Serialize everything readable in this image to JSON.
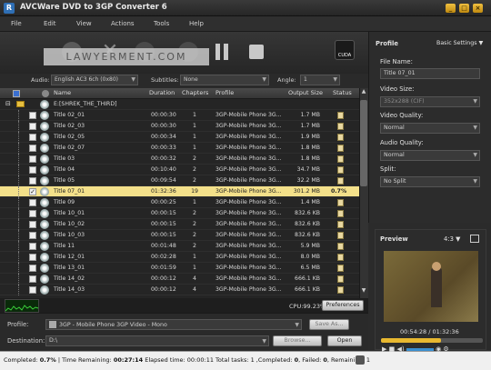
{
  "window": {
    "title": "AVCWare DVD to 3GP Converter 6",
    "logo_letter": "R"
  },
  "menu": [
    "File",
    "Edit",
    "View",
    "Actions",
    "Tools",
    "Help"
  ],
  "toolbar": {
    "watermark": "LAWYERMENT.COM",
    "cuda_label": "CUDA"
  },
  "options": {
    "audio_label": "Audio:",
    "audio_value": "English AC3 6ch (0x80)",
    "subtitles_label": "Subtitles:",
    "subtitles_value": "None",
    "angle_label": "Angle:",
    "angle_value": "1"
  },
  "table": {
    "headers": {
      "name": "Name",
      "duration": "Duration",
      "chapters": "Chapters",
      "profile": "Profile",
      "output_size": "Output Size",
      "status": "Status"
    },
    "root": "E:[SHREK_THE_THIRD]",
    "rows": [
      {
        "name": "Title 02_01",
        "duration": "00:00:30",
        "chapters": "1",
        "profile": "3GP-Mobile Phone 3G...",
        "size": "1.7 MB",
        "status": ""
      },
      {
        "name": "Title 02_03",
        "duration": "00:00:30",
        "chapters": "1",
        "profile": "3GP-Mobile Phone 3G...",
        "size": "1.7 MB",
        "status": ""
      },
      {
        "name": "Title 02_05",
        "duration": "00:00:34",
        "chapters": "1",
        "profile": "3GP-Mobile Phone 3G...",
        "size": "1.9 MB",
        "status": ""
      },
      {
        "name": "Title 02_07",
        "duration": "00:00:33",
        "chapters": "1",
        "profile": "3GP-Mobile Phone 3G...",
        "size": "1.8 MB",
        "status": ""
      },
      {
        "name": "Title 03",
        "duration": "00:00:32",
        "chapters": "2",
        "profile": "3GP-Mobile Phone 3G...",
        "size": "1.8 MB",
        "status": ""
      },
      {
        "name": "Title 04",
        "duration": "00:10:40",
        "chapters": "2",
        "profile": "3GP-Mobile Phone 3G...",
        "size": "34.7 MB",
        "status": ""
      },
      {
        "name": "Title 05",
        "duration": "00:09:54",
        "chapters": "2",
        "profile": "3GP-Mobile Phone 3G...",
        "size": "32.2 MB",
        "status": ""
      },
      {
        "name": "Title 07_01",
        "duration": "01:32:36",
        "chapters": "19",
        "profile": "3GP-Mobile Phone 3G...",
        "size": "301.2 MB",
        "status": "0.7%",
        "selected": true
      },
      {
        "name": "Title 09",
        "duration": "00:00:25",
        "chapters": "1",
        "profile": "3GP-Mobile Phone 3G...",
        "size": "1.4 MB",
        "status": ""
      },
      {
        "name": "Title 10_01",
        "duration": "00:00:15",
        "chapters": "2",
        "profile": "3GP-Mobile Phone 3G...",
        "size": "832.6 KB",
        "status": ""
      },
      {
        "name": "Title 10_02",
        "duration": "00:00:15",
        "chapters": "2",
        "profile": "3GP-Mobile Phone 3G...",
        "size": "832.6 KB",
        "status": ""
      },
      {
        "name": "Title 10_03",
        "duration": "00:00:15",
        "chapters": "2",
        "profile": "3GP-Mobile Phone 3G...",
        "size": "832.6 KB",
        "status": ""
      },
      {
        "name": "Title 11",
        "duration": "00:01:48",
        "chapters": "2",
        "profile": "3GP-Mobile Phone 3G...",
        "size": "5.9 MB",
        "status": ""
      },
      {
        "name": "Title 12_01",
        "duration": "00:02:28",
        "chapters": "1",
        "profile": "3GP-Mobile Phone 3G...",
        "size": "8.0 MB",
        "status": ""
      },
      {
        "name": "Title 13_01",
        "duration": "00:01:59",
        "chapters": "1",
        "profile": "3GP-Mobile Phone 3G...",
        "size": "6.5 MB",
        "status": ""
      },
      {
        "name": "Title 14_02",
        "duration": "00:00:12",
        "chapters": "4",
        "profile": "3GP-Mobile Phone 3G...",
        "size": "666.1 KB",
        "status": ""
      },
      {
        "name": "Title 14_03",
        "duration": "00:00:12",
        "chapters": "4",
        "profile": "3GP-Mobile Phone 3G...",
        "size": "666.1 KB",
        "status": ""
      }
    ]
  },
  "cpu": {
    "text": "CPU:99.23%",
    "preferences": "Preferences"
  },
  "bottom": {
    "profile_label": "Profile:",
    "profile_value": "3GP - Mobile Phone 3GP Video - Mono",
    "save_as": "Save As...",
    "destination_label": "Destination:",
    "destination_value": "D:\\",
    "browse": "Browse...",
    "open": "Open"
  },
  "status_bar": {
    "text_prefix": "Completed: ",
    "completed": "0.7%",
    "text_mid": " | Time Remaining: ",
    "remaining": "00:27:14",
    "text_rest": " Elapsed time: 00:00:11 Total tasks: 1 ,Completed: ",
    "done_count": "0",
    "failed_text": ", Failed: ",
    "failed_count": "0",
    "remaining_text": ", Remaining: 1"
  },
  "right_panel": {
    "title": "Profile",
    "basic_settings": "Basic Settings",
    "file_name_label": "File Name:",
    "file_name_value": "Title 07_01",
    "video_size_label": "Video Size:",
    "video_size_value": "352x288 (CIF)",
    "video_quality_label": "Video Quality:",
    "video_quality_value": "Normal",
    "audio_quality_label": "Audio Quality:",
    "audio_quality_value": "Normal",
    "split_label": "Split:",
    "split_value": "No Split"
  },
  "preview": {
    "title": "Preview",
    "ratio": "4:3",
    "time": "00:54:28 / 01:32:36",
    "progress": 0.59
  }
}
